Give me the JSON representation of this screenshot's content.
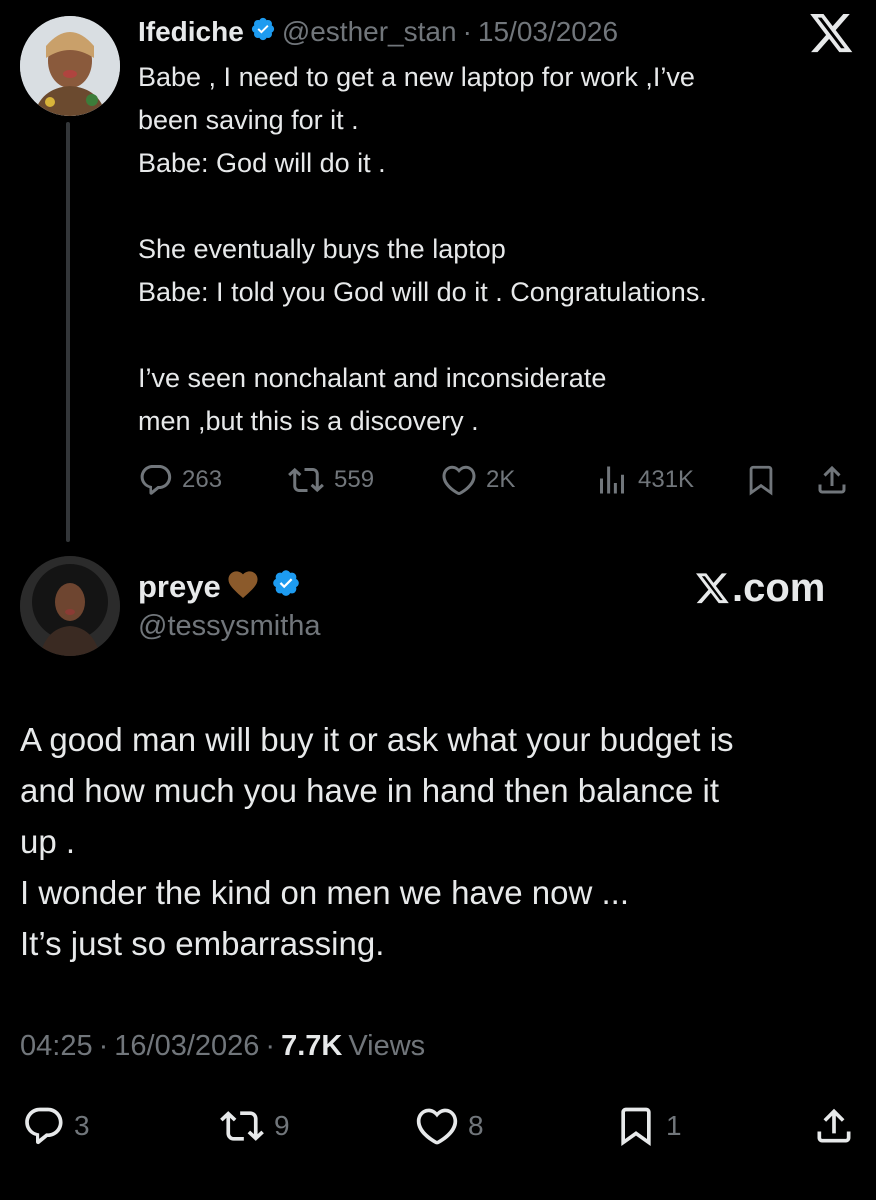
{
  "colors": {
    "background": "#000000",
    "text": "#e7e9ea",
    "muted": "#71767b",
    "verified": "#1d9bf0",
    "heart_emoji": "#8b5a2b"
  },
  "quoted_tweet": {
    "display_name": "Ifediche",
    "handle": "@esther_stan",
    "separator": "·",
    "date": "15/03/2026",
    "platform_icon": "x-logo-icon",
    "text": "Babe , I need to get a new laptop for work ,I’ve\nbeen saving for it .\nBabe: God will do it .\n\nShe eventually buys the laptop\nBabe: I told you God will do it . Congratulations.\n\nI’ve seen nonchalant and inconsiderate\nmen ,but this is a discovery .",
    "actions": {
      "replies": "263",
      "reposts": "559",
      "likes": "2K",
      "views": "431K"
    }
  },
  "main_tweet": {
    "display_name": "preye",
    "name_emoji": "🤎",
    "handle": "@tessysmitha",
    "watermark": "X.com",
    "text": "A good man will buy it or ask what your budget is\nand how much you have in hand then balance it\nup .\nI wonder the kind on men we have now ...\nIt’s just so embarrassing.",
    "time": "04:25",
    "date": "16/03/2026",
    "separator": "·",
    "views_count": "7.7K",
    "views_label": "Views",
    "actions": {
      "replies": "3",
      "reposts": "9",
      "likes": "8",
      "bookmarks": "1"
    }
  }
}
